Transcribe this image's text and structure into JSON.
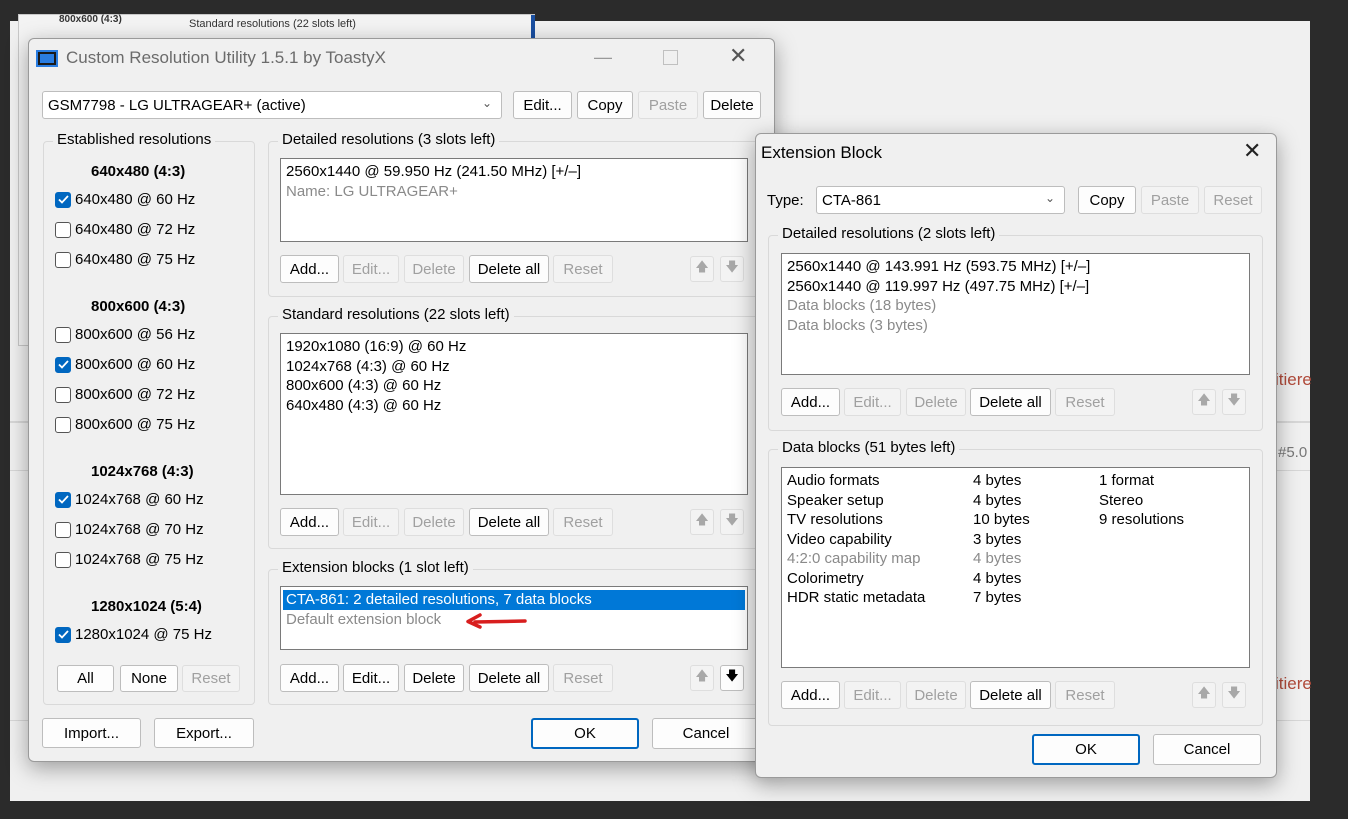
{
  "background": {
    "right_text_1": "itiere",
    "right_text_2": "#5.0",
    "right_text_3": "itiere",
    "behind_window_label": "Standard resolutions (22 slots left)",
    "behind_window_label2": "800x600 (4:3)"
  },
  "main": {
    "title": "Custom Resolution Utility 1.5.1 by ToastyX",
    "monitor_select": "GSM7798 - LG ULTRAGEAR+ (active)",
    "top_buttons": {
      "edit": "Edit...",
      "copy": "Copy",
      "paste": "Paste",
      "delete": "Delete"
    },
    "established": {
      "label": "Established resolutions",
      "groups": [
        {
          "heading": "640x480 (4:3)",
          "items": [
            {
              "label": "640x480 @ 60 Hz",
              "checked": true
            },
            {
              "label": "640x480 @ 72 Hz",
              "checked": false
            },
            {
              "label": "640x480 @ 75 Hz",
              "checked": false
            }
          ]
        },
        {
          "heading": "800x600 (4:3)",
          "items": [
            {
              "label": "800x600 @ 56 Hz",
              "checked": false
            },
            {
              "label": "800x600 @ 60 Hz",
              "checked": true
            },
            {
              "label": "800x600 @ 72 Hz",
              "checked": false
            },
            {
              "label": "800x600 @ 75 Hz",
              "checked": false
            }
          ]
        },
        {
          "heading": "1024x768 (4:3)",
          "items": [
            {
              "label": "1024x768 @ 60 Hz",
              "checked": true
            },
            {
              "label": "1024x768 @ 70 Hz",
              "checked": false
            },
            {
              "label": "1024x768 @ 75 Hz",
              "checked": false
            }
          ]
        },
        {
          "heading": "1280x1024 (5:4)",
          "items": [
            {
              "label": "1280x1024 @ 75 Hz",
              "checked": true
            }
          ]
        }
      ],
      "buttons": {
        "all": "All",
        "none": "None",
        "reset": "Reset"
      }
    },
    "detailed": {
      "label": "Detailed resolutions (3 slots left)",
      "items": [
        "2560x1440 @ 59.950 Hz (241.50 MHz) [+/–]"
      ],
      "name_line": "Name: LG ULTRAGEAR+"
    },
    "standard": {
      "label": "Standard resolutions (22 slots left)",
      "items": [
        "1920x1080 (16:9) @ 60 Hz",
        "1024x768 (4:3) @ 60 Hz",
        "800x600 (4:3) @ 60 Hz",
        "640x480 (4:3) @ 60 Hz"
      ]
    },
    "extension": {
      "label": "Extension blocks (1 slot left)",
      "selected_item": "CTA-861: 2 detailed resolutions, 7 data blocks",
      "default_item": "Default extension block"
    },
    "list_buttons": {
      "add": "Add...",
      "edit": "Edit...",
      "delete": "Delete",
      "delete_all": "Delete all",
      "reset": "Reset"
    },
    "bottom_buttons": {
      "import": "Import...",
      "export": "Export...",
      "ok": "OK",
      "cancel": "Cancel"
    }
  },
  "ext": {
    "title": "Extension Block",
    "type_label": "Type:",
    "type_value": "CTA-861",
    "top_buttons": {
      "copy": "Copy",
      "paste": "Paste",
      "reset": "Reset"
    },
    "detailed": {
      "label": "Detailed resolutions (2 slots left)",
      "items": [
        "2560x1440 @ 143.991 Hz (593.75 MHz) [+/–]",
        "2560x1440 @ 119.997 Hz (497.75 MHz) [+/–]"
      ],
      "gray_items": [
        "Data blocks (18 bytes)",
        "Data blocks (3 bytes)"
      ]
    },
    "datablocks": {
      "label": "Data blocks (51 bytes left)",
      "rows": [
        {
          "name": "Audio formats",
          "size": "4 bytes",
          "info": "1 format",
          "gray": false
        },
        {
          "name": "Speaker setup",
          "size": "4 bytes",
          "info": "Stereo",
          "gray": false
        },
        {
          "name": "TV resolutions",
          "size": "10 bytes",
          "info": "9 resolutions",
          "gray": false
        },
        {
          "name": "Video capability",
          "size": "3 bytes",
          "info": "",
          "gray": false
        },
        {
          "name": "4:2:0 capability map",
          "size": "4 bytes",
          "info": "",
          "gray": true
        },
        {
          "name": "Colorimetry",
          "size": "4 bytes",
          "info": "",
          "gray": false
        },
        {
          "name": "HDR static metadata",
          "size": "7 bytes",
          "info": "",
          "gray": false
        }
      ]
    },
    "list_buttons": {
      "add": "Add...",
      "edit": "Edit...",
      "delete": "Delete",
      "delete_all": "Delete all",
      "reset": "Reset"
    },
    "bottom_buttons": {
      "ok": "OK",
      "cancel": "Cancel"
    }
  },
  "colors": {
    "accent": "#0067c0",
    "selection": "#0078d7",
    "arrow": "#d81e1e"
  }
}
